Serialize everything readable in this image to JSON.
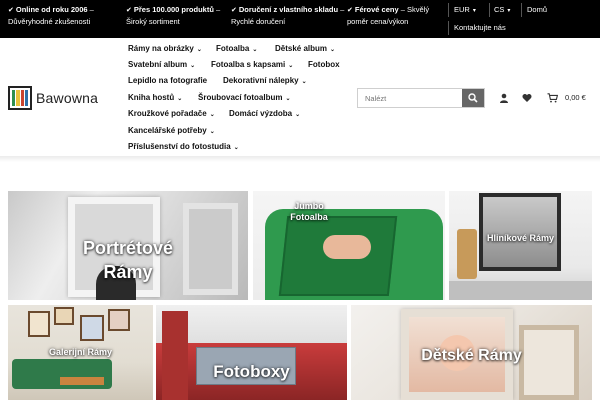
{
  "topbar": {
    "usps": [
      {
        "bold": "Online od roku 2006",
        "rest": " –",
        "line2": "Důvěryhodné zkušenosti"
      },
      {
        "bold": "Přes 100.000 produktů",
        "rest": " –",
        "line2": "Široký sortiment"
      },
      {
        "bold": "Doručení z vlastního skladu",
        "rest": " –",
        "line2": "Rychlé doručení"
      },
      {
        "bold": "Férové ceny",
        "rest": " – Skvělý",
        "line2": "poměr cena/výkon"
      }
    ],
    "currency": "EUR",
    "language": "CS",
    "home": "Domů",
    "contact": "Kontaktujte nás"
  },
  "logo": {
    "text": "Bawowna"
  },
  "nav": {
    "items": [
      {
        "label": "Rámy na obrázky",
        "dropdown": true
      },
      {
        "label": "Fotoalba",
        "dropdown": true
      },
      {
        "label": "Dětské album",
        "dropdown": true
      },
      {
        "label": "Svatební album",
        "dropdown": true
      },
      {
        "label": "Fotoalba s kapsami",
        "dropdown": true
      },
      {
        "label": "Fotobox",
        "dropdown": false
      },
      {
        "label": "Lepidlo na fotografie",
        "dropdown": false
      },
      {
        "label": "Dekorativní nálepky",
        "dropdown": true
      },
      {
        "label": "Kniha hostů",
        "dropdown": true
      },
      {
        "label": "Šroubovací fotoalbum",
        "dropdown": true
      },
      {
        "label": "Kroužkové pořadače",
        "dropdown": true
      },
      {
        "label": "Domácí výzdoba",
        "dropdown": true
      },
      {
        "label": "Kancelářské potřeby",
        "dropdown": true
      },
      {
        "label": "Příslušenství do fotostudia",
        "dropdown": true
      }
    ]
  },
  "search": {
    "placeholder": "Nalézt"
  },
  "cart": {
    "total": "0,00 €"
  },
  "tiles": {
    "t1": {
      "line1": "Portrétové",
      "line2": "Rámy"
    },
    "t2": {
      "line1": "Jumbo",
      "line2": "Fotoalba"
    },
    "t3": {
      "label": "Hliníkové Rámy"
    },
    "t4": {
      "label": "Galerijní Rámy"
    },
    "t5": {
      "label": "Fotoboxy"
    },
    "t6": {
      "label": "Dětské Rámy"
    }
  },
  "colors": {
    "topbar": "#000000",
    "search_button": "#666666",
    "logo_stripes": [
      "#2f8f4e",
      "#e7c23a",
      "#c8442f",
      "#2d6fa8"
    ]
  }
}
